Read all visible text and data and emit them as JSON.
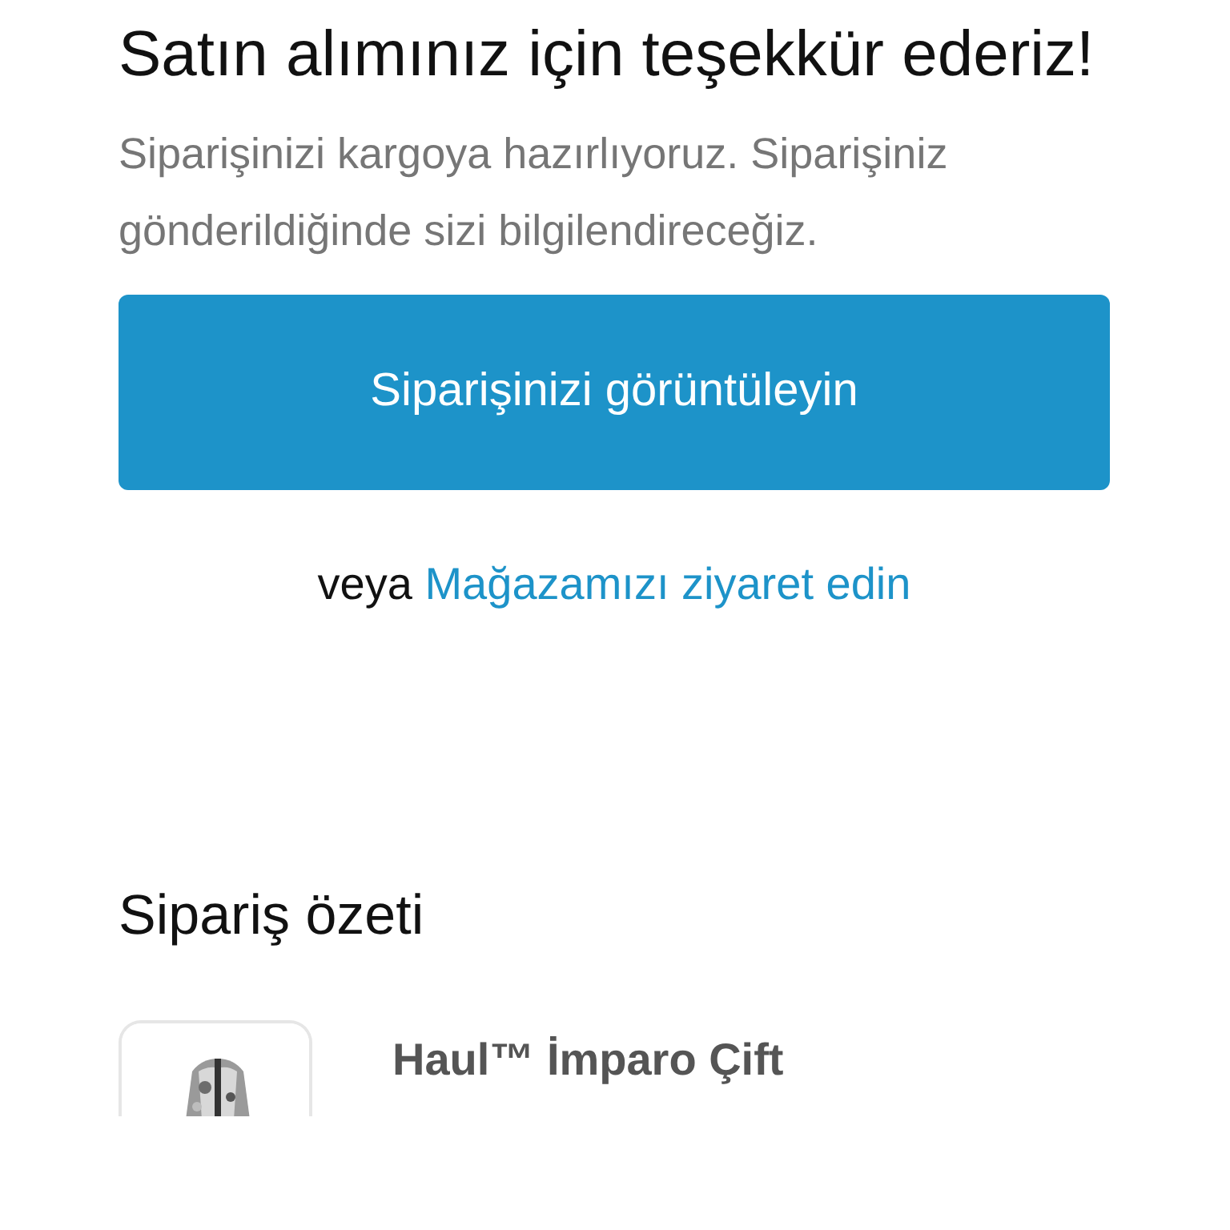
{
  "heading": "Satın alımınız için teşekkür ederiz!",
  "message": "Siparişinizi kargoya hazırlıyoruz. Siparişiniz gönderildiğinde sizi bilgilendireceğiz.",
  "primary_button": "Siparişinizi görüntüleyin",
  "alt_prefix": "veya",
  "alt_link": "Mağazamızı ziyaret edin",
  "summary": {
    "title": "Sipariş özeti",
    "items": [
      {
        "kind": "picture",
        "name": "Haul™ İmparo Çift"
      }
    ]
  }
}
